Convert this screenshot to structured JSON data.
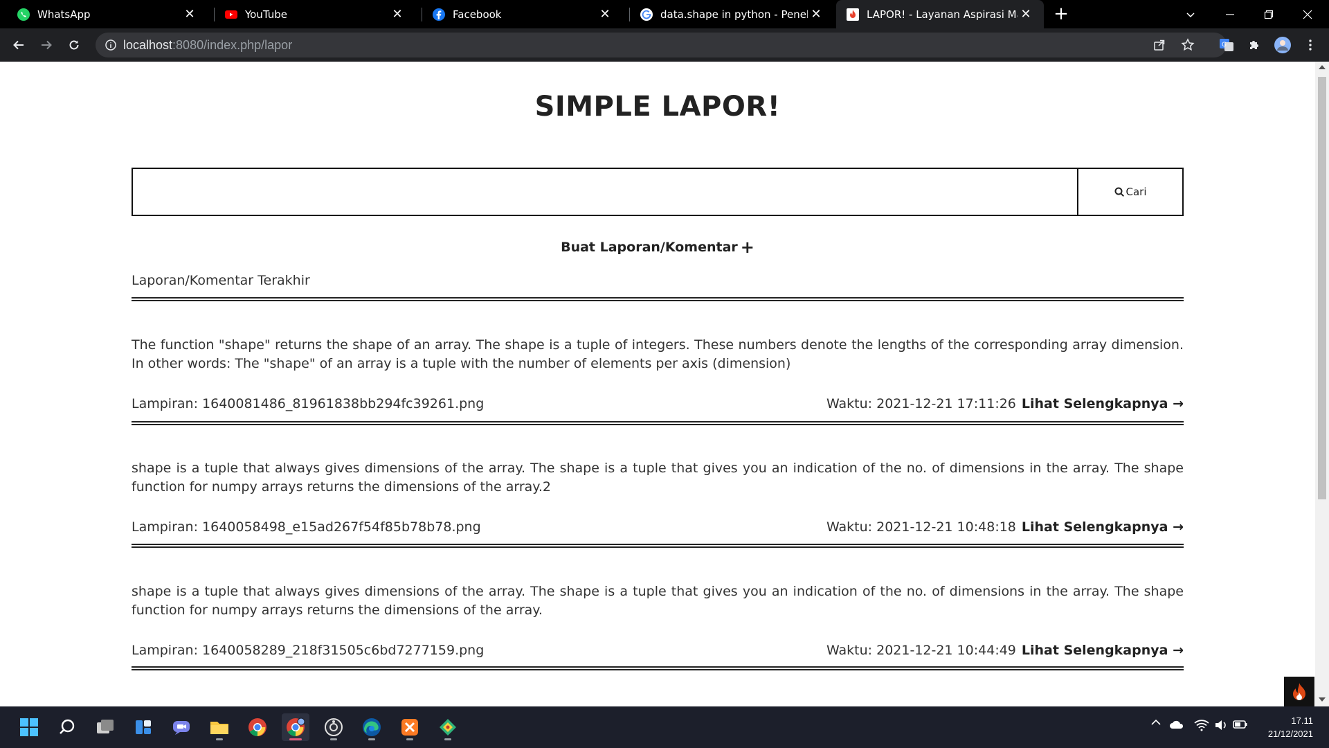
{
  "browser": {
    "tabs": [
      {
        "title": "WhatsApp",
        "icon": "whatsapp-icon",
        "active": false
      },
      {
        "title": "YouTube",
        "icon": "youtube-icon",
        "active": false
      },
      {
        "title": "Facebook",
        "icon": "facebook-icon",
        "active": false
      },
      {
        "title": "data.shape in python - Penelusur",
        "icon": "google-icon",
        "active": false
      },
      {
        "title": "LAPOR! - Layanan Aspirasi Masya",
        "icon": "lapor-icon",
        "active": true
      }
    ],
    "url_host": "localhost",
    "url_rest": ":8080/index.php/lapor"
  },
  "page": {
    "title": "SIMPLE LAPOR!",
    "search": {
      "placeholder": "",
      "value": "",
      "button_label": "Cari"
    },
    "create_label": "Buat Laporan/Komentar",
    "create_icon": "+",
    "section_label": "Laporan/Komentar Terakhir",
    "attachment_prefix": "Lampiran:",
    "time_prefix": "Waktu:",
    "more_label": "Lihat Selengkapnya →",
    "reports": [
      {
        "text": "The function \"shape\" returns the shape of an array. The shape is a tuple of integers. These numbers denote the lengths of the corresponding array dimension. In other words: The \"shape\" of an array is a tuple with the number of elements per axis (dimension)",
        "attachment": "Lampiran: 1640081486_81961838bb294fc39261.png",
        "time": "Waktu: 2021-12-21 17:11:26"
      },
      {
        "text": "shape is a tuple that always gives dimensions of the array. The shape is a tuple that gives you an indication of the no. of dimensions in the array. The shape function for numpy arrays returns the dimensions of the array.2",
        "attachment": "Lampiran: 1640058498_e15ad267f54f85b78b78.png",
        "time": "Waktu: 2021-12-21 10:48:18"
      },
      {
        "text": "shape is a tuple that always gives dimensions of the array. The shape is a tuple that gives you an indication of the no. of dimensions in the array. The shape function for numpy arrays returns the dimensions of the array.",
        "attachment": "Lampiran: 1640058289_218f31505c6bd7277159.png",
        "time": "Waktu: 2021-12-21 10:44:49"
      }
    ]
  },
  "taskbar": {
    "apps": [
      "windows-start-icon",
      "search-icon",
      "task-view-icon",
      "widgets-icon",
      "chat-icon",
      "file-explorer-icon",
      "chrome-icon",
      "chrome-profile-icon",
      "obs-icon",
      "edge-icon",
      "xampp-icon",
      "git-kraken-icon"
    ],
    "clock_time": "17.11",
    "clock_date": "21/12/2021"
  },
  "colors": {
    "tabstrip": "#000000",
    "toolbar": "#202124",
    "omnibox": "#35363a",
    "taskbar": "#1c1f2b",
    "text": "#333333"
  }
}
